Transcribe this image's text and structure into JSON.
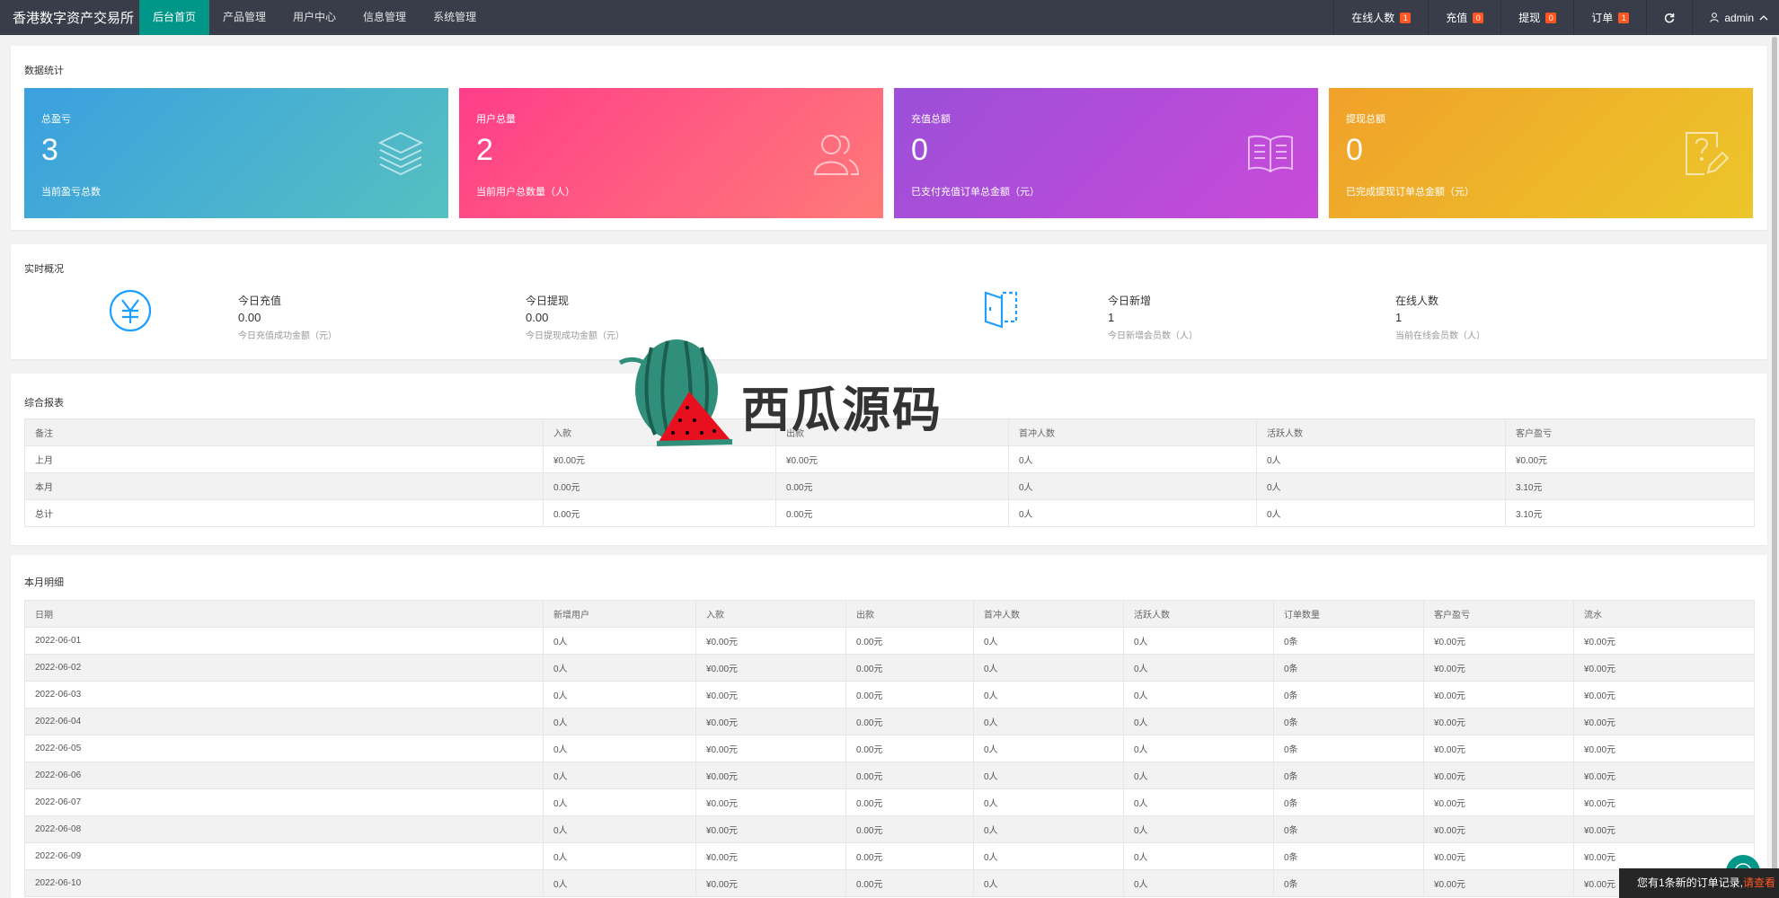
{
  "brand": "香港数字资产交易所",
  "nav": [
    {
      "label": "后台首页",
      "active": true
    },
    {
      "label": "产品管理"
    },
    {
      "label": "用户中心"
    },
    {
      "label": "信息管理"
    },
    {
      "label": "系统管理"
    }
  ],
  "topright": {
    "online": {
      "label": "在线人数",
      "count": "1"
    },
    "recharge": {
      "label": "充值",
      "count": "0"
    },
    "withdraw": {
      "label": "提现",
      "count": "0"
    },
    "orders": {
      "label": "订单",
      "count": "1"
    },
    "user": "admin"
  },
  "stats": {
    "title": "数据统计",
    "cards": [
      {
        "label": "总盈亏",
        "value": "3",
        "sub": "当前盈亏总数",
        "icon": "layers-icon",
        "gradient": [
          "#3aa0e0",
          "#56c0c0"
        ]
      },
      {
        "label": "用户总量",
        "value": "2",
        "sub": "当前用户总数量（人）",
        "icon": "users-icon",
        "gradient": [
          "#ff3d8a",
          "#ff7a78"
        ]
      },
      {
        "label": "充值总额",
        "value": "0",
        "sub": "已支付充值订单总金额（元）",
        "icon": "book-icon",
        "gradient": [
          "#9b4fd8",
          "#c94ad9"
        ]
      },
      {
        "label": "提现总额",
        "value": "0",
        "sub": "已完成提现订单总金额（元）",
        "icon": "edit-doc-icon",
        "gradient": [
          "#f0a12a",
          "#ecc62a"
        ]
      }
    ]
  },
  "realtime": {
    "title": "实时概况",
    "items": [
      {
        "title": "今日充值",
        "value": "0.00",
        "sub": "今日充值成功金额（元）"
      },
      {
        "title": "今日提现",
        "value": "0.00",
        "sub": "今日提现成功金额（元）"
      },
      {
        "title": "今日新增",
        "value": "1",
        "sub": "今日新增会员数（人）"
      },
      {
        "title": "在线人数",
        "value": "1",
        "sub": "当前在线会员数（人）"
      }
    ]
  },
  "report": {
    "title": "综合报表",
    "columns": [
      "备注",
      "入款",
      "出款",
      "首冲人数",
      "活跃人数",
      "客户盈亏"
    ],
    "rows": [
      [
        "上月",
        "¥0.00元",
        "¥0.00元",
        "0人",
        "0人",
        "¥0.00元"
      ],
      [
        "本月",
        "0.00元",
        "0.00元",
        "0人",
        "0人",
        "3.10元"
      ],
      [
        "总计",
        "0.00元",
        "0.00元",
        "0人",
        "0人",
        "3.10元"
      ]
    ]
  },
  "monthly": {
    "title": "本月明细",
    "columns": [
      "日期",
      "新增用户",
      "入款",
      "出款",
      "首冲人数",
      "活跃人数",
      "订单数量",
      "客户盈亏",
      "流水"
    ],
    "rows": [
      [
        "2022-06-01",
        "0人",
        "¥0.00元",
        "0.00元",
        "0人",
        "0人",
        "0条",
        "¥0.00元",
        "¥0.00元"
      ],
      [
        "2022-06-02",
        "0人",
        "¥0.00元",
        "0.00元",
        "0人",
        "0人",
        "0条",
        "¥0.00元",
        "¥0.00元"
      ],
      [
        "2022-06-03",
        "0人",
        "¥0.00元",
        "0.00元",
        "0人",
        "0人",
        "0条",
        "¥0.00元",
        "¥0.00元"
      ],
      [
        "2022-06-04",
        "0人",
        "¥0.00元",
        "0.00元",
        "0人",
        "0人",
        "0条",
        "¥0.00元",
        "¥0.00元"
      ],
      [
        "2022-06-05",
        "0人",
        "¥0.00元",
        "0.00元",
        "0人",
        "0人",
        "0条",
        "¥0.00元",
        "¥0.00元"
      ],
      [
        "2022-06-06",
        "0人",
        "¥0.00元",
        "0.00元",
        "0人",
        "0人",
        "0条",
        "¥0.00元",
        "¥0.00元"
      ],
      [
        "2022-06-07",
        "0人",
        "¥0.00元",
        "0.00元",
        "0人",
        "0人",
        "0条",
        "¥0.00元",
        "¥0.00元"
      ],
      [
        "2022-06-08",
        "0人",
        "¥0.00元",
        "0.00元",
        "0人",
        "0人",
        "0条",
        "¥0.00元",
        "¥0.00元"
      ],
      [
        "2022-06-09",
        "0人",
        "¥0.00元",
        "0.00元",
        "0人",
        "0人",
        "0条",
        "¥0.00元",
        "¥0.00元"
      ],
      [
        "2022-06-10",
        "0人",
        "¥0.00元",
        "0.00元",
        "0人",
        "0人",
        "0条",
        "¥0.00元",
        "¥0.00元"
      ]
    ]
  },
  "toast": {
    "text": "您有1条新的订单记录,",
    "link": "请查看"
  },
  "watermark": "西瓜源码"
}
